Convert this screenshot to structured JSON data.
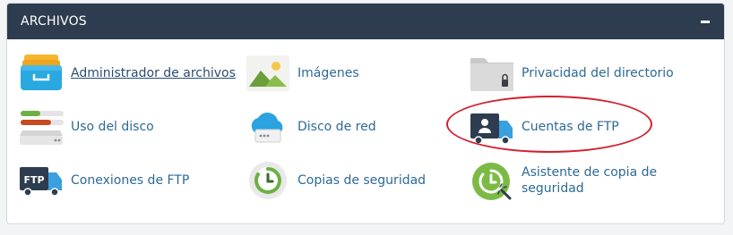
{
  "panel": {
    "title": "ARCHIVOS",
    "collapse_icon": "minus-icon"
  },
  "items": [
    {
      "label": "Administrador de archivos",
      "icon": "file-manager-icon"
    },
    {
      "label": "Imágenes",
      "icon": "images-icon"
    },
    {
      "label": "Privacidad del directorio",
      "icon": "directory-privacy-icon"
    },
    {
      "label": "Uso del disco",
      "icon": "disk-usage-icon"
    },
    {
      "label": "Disco de red",
      "icon": "web-disk-icon"
    },
    {
      "label": "Cuentas de FTP",
      "icon": "ftp-accounts-icon"
    },
    {
      "label": "Conexiones de FTP",
      "icon": "ftp-connections-icon",
      "badge": "FTP"
    },
    {
      "label": "Copias de seguridad",
      "icon": "backup-icon"
    },
    {
      "label": "Asistente de copia de seguridad",
      "icon": "backup-wizard-icon"
    }
  ],
  "colors": {
    "header_bg": "#2d3d4f",
    "link": "#2d6a96",
    "highlight": "#d2202f"
  }
}
